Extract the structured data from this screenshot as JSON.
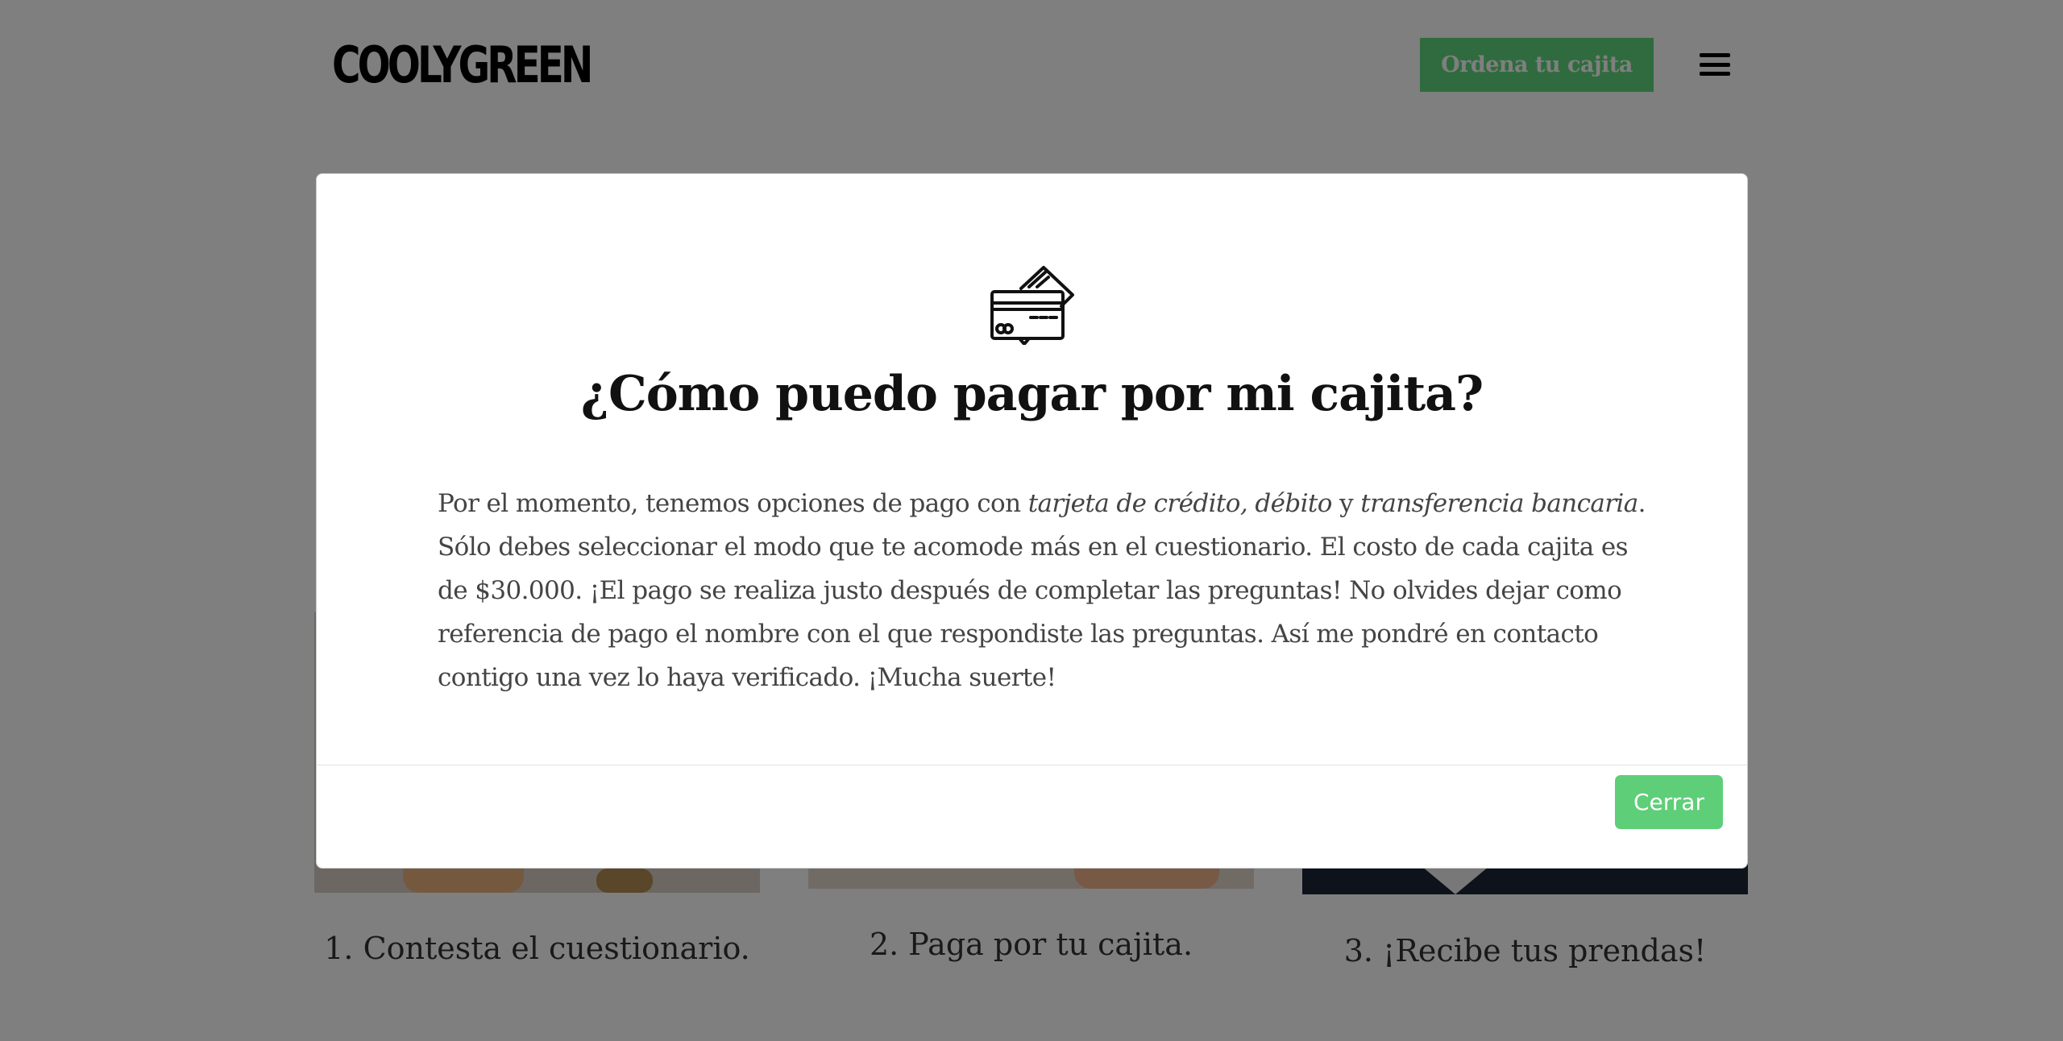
{
  "header": {
    "logo": "COOLYGREEN",
    "order_button": "Ordena tu cajita",
    "menu_icon": "hamburger-menu-icon"
  },
  "steps": [
    {
      "label": "1. Contesta el cuestionario."
    },
    {
      "label": "2. Paga por tu cajita."
    },
    {
      "label": "3. ¡Recibe tus prendas!"
    }
  ],
  "modal": {
    "icon": "credit-card-icon",
    "title": "¿Cómo puedo pagar por mi cajita?",
    "body": {
      "intro": "Por el momento, tenemos opciones de pago con ",
      "card": "tarjeta de crédito",
      "comma": ", ",
      "debit": "débito",
      "and": " y ",
      "transfer": "transferencia bancaria",
      "rest": ". Sólo debes seleccionar el modo que te acomode más en el cuestionario. El costo de cada cajita es de $30.000. ¡El pago se realiza justo después de completar las preguntas! No olvides dejar como referencia de pago el nombre con el que respondiste las preguntas. Así me pondré en contacto contigo una vez lo haya verificado. ¡Mucha suerte!"
    },
    "close_button": "Cerrar"
  },
  "colors": {
    "accent_green": "#5ecf78",
    "backdrop": "rgba(0,0,0,0.5)"
  }
}
